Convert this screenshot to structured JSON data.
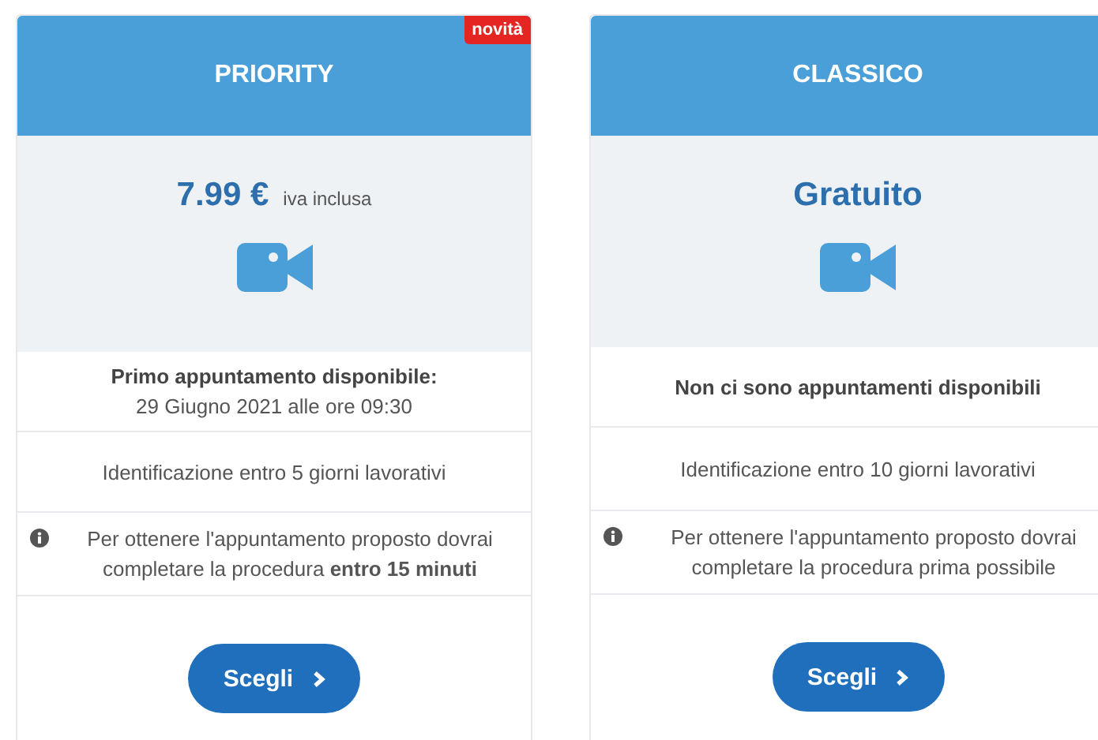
{
  "plans": [
    {
      "title": "PRIORITY",
      "badge": "novità",
      "price": "7.99 €",
      "price_note": "iva inclusa",
      "appointment": {
        "title": "Primo appuntamento disponibile:",
        "detail": "29 Giugno 2021 alle ore 09:30"
      },
      "identification": "Identificazione entro 5 giorni lavorativi",
      "info": "Per ottenere l'appuntamento proposto dovrai completare la procedura **entro 15 minuti**",
      "button": "Scegli"
    },
    {
      "title": "CLASSICO",
      "price": "Gratuito",
      "appointment": {
        "title": "Non ci sono appuntamenti disponibili"
      },
      "identification": "Identificazione entro 10 giorni lavorativi",
      "info": "Per ottenere l'appuntamento proposto dovrai completare la procedura prima possibile",
      "button": "Scegli"
    }
  ]
}
